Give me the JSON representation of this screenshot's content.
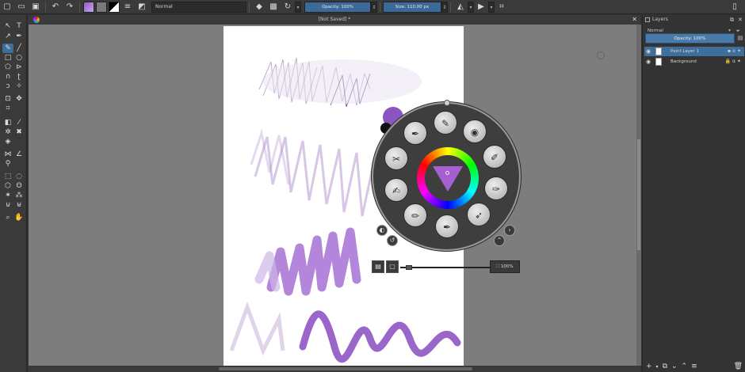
{
  "app": {
    "document_title": "[Not Saved]  *"
  },
  "toolbar": {
    "blend_mode": "Normal",
    "opacity_label": "Opacity: 100%",
    "size_label": "Size: 110.00 px",
    "icons": [
      "new-document-icon",
      "open-icon",
      "save-icon",
      "undo-icon",
      "redo-icon",
      "gradient-swatch",
      "pattern-swatch",
      "fg-bg-swatch",
      "brush-settings-icon",
      "brush-preset-icon",
      "eraser-icon",
      "alpha-lock-icon",
      "reload-icon",
      "mirror-icon",
      "wrap-icon",
      "crop-icon"
    ]
  },
  "layers": {
    "panel_title": "Layers",
    "blend_mode": "Normal",
    "opacity_label": "Opacity: 100%",
    "items": [
      {
        "name": "Paint Layer 1",
        "selected": true
      },
      {
        "name": "Background",
        "selected": false
      }
    ]
  },
  "palette": {
    "zoom_label": "100%",
    "fg_color": "#8a55c2",
    "bg_color": "#111111",
    "brushes": [
      "ink-pen",
      "pencil",
      "airbrush",
      "marker",
      "chalk",
      "blender",
      "smudge",
      "bristle",
      "watercolor",
      "fill"
    ]
  },
  "colors": {
    "accent": "#3d6e9c",
    "canvas_bg": "#7d7d7d",
    "stroke": "#8f58c8"
  }
}
